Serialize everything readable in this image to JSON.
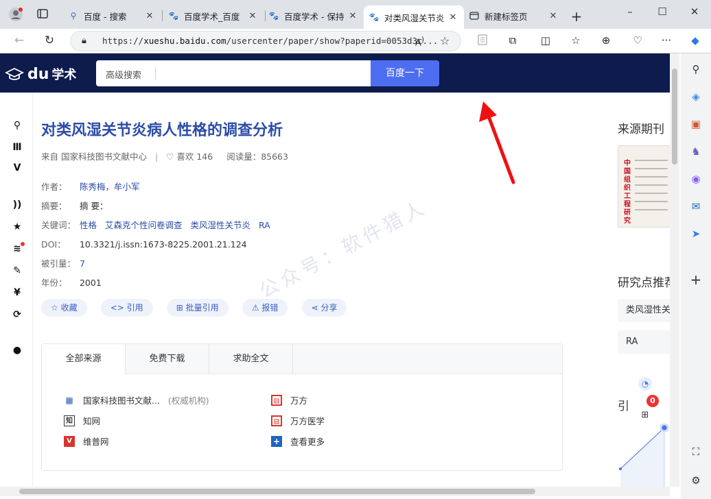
{
  "tabs": [
    {
      "title": "",
      "icon": "profile-icon"
    },
    {
      "title": "",
      "icon": "tab-actions-icon"
    },
    {
      "title": "百度 - 搜索",
      "icon": "search-icon"
    },
    {
      "title": "百度学术_百度",
      "icon": "baidu-paw-icon"
    },
    {
      "title": "百度学术 - 保持",
      "icon": "baidu-paw-icon"
    },
    {
      "title": "对类风湿关节炎",
      "icon": "baidu-paw-icon"
    },
    {
      "title": "新建标签页",
      "icon": "newtab-icon"
    }
  ],
  "address": {
    "url_prefix": "https://",
    "url_domain": "xueshu.baidu.com",
    "url_path": "/usercenter/paper/show?paperid=0053d3c..."
  },
  "site": {
    "logo_text": "学术",
    "search_placeholder": "高级搜索",
    "search_button": "百度一下"
  },
  "paper": {
    "title": "对类风湿关节炎病人性格的调查分析",
    "source": "来自 国家科技图书文献中心",
    "likes": "喜欢 146",
    "reads": "阅读量：85663",
    "authors_label": "作者：",
    "authors": "陈秀梅，牟小军",
    "abstract_label": "摘要：",
    "abstract": "摘    要：",
    "keywords_label": "关键词：",
    "keywords": [
      "性格",
      "艾森克个性问卷调查",
      "类风湿性关节炎",
      "RA"
    ],
    "doi_label": "DOI：",
    "doi": "10.3321/j.issn:1673-8225.2001.21.124",
    "cited_label": "被引量：",
    "cited": "7",
    "year_label": "年份：",
    "year": "2001"
  },
  "actions": {
    "collect": "☆ 收藏",
    "cite": "<> 引用",
    "batch_cite": "批量引用",
    "report": "报错",
    "share": "分享"
  },
  "sources": {
    "tabs": [
      "全部来源",
      "免费下载",
      "求助全文"
    ],
    "left": [
      {
        "name": "国家科技图书文献...",
        "note": "(权威机构)"
      },
      {
        "name": "知网",
        "note": ""
      },
      {
        "name": "维普网",
        "note": ""
      }
    ],
    "right": [
      {
        "name": "万方"
      },
      {
        "name": "万方医学"
      },
      {
        "name": "查看更多"
      }
    ]
  },
  "right_panel": {
    "journal_head": "来源期刊",
    "journal_cover_text": "中国组织工程研究",
    "research_head": "研究点推荐",
    "keywords": [
      "类风湿性关节炎",
      "RA"
    ],
    "cite_head": "引",
    "badge": "0"
  },
  "watermark": "公众号：软件猎人",
  "colors": {
    "header_bg": "#0e1b4d",
    "accent": "#4e6ef2",
    "link": "#2b4ca8"
  }
}
